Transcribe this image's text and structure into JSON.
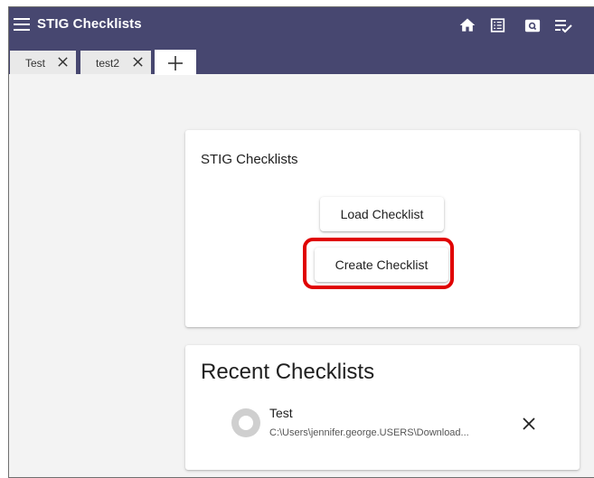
{
  "app": {
    "title": "STIG Checklists",
    "accent_color": "#474770",
    "highlight_color": "#e00000"
  },
  "toolbar": {
    "icons": [
      "home-icon",
      "list-icon",
      "search-icon",
      "checklist-icon"
    ]
  },
  "tabs": [
    {
      "label": "Test",
      "icon": "close-icon"
    },
    {
      "label": "test2",
      "icon": "close-icon"
    }
  ],
  "add_tab_icon": "plus-icon",
  "checklists_card": {
    "title": "STIG Checklists",
    "load_label": "Load Checklist",
    "create_label": "Create Checklist"
  },
  "recent": {
    "title": "Recent Checklists",
    "items": [
      {
        "name": "Test",
        "path": "C:\\Users\\jennifer.george.USERS\\Download...",
        "icon": "circle-avatar-icon",
        "remove_icon": "close-icon"
      }
    ]
  }
}
